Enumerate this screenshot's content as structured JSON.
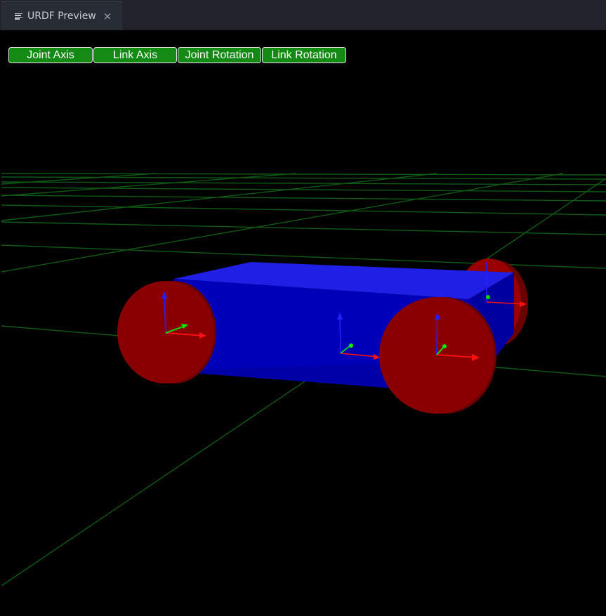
{
  "tab": {
    "title": "URDF Preview",
    "icon": "preview-lines-icon",
    "close_icon": "close-icon",
    "close_glyph": "×"
  },
  "toolbar": {
    "buttons": [
      {
        "label": "Joint Axis"
      },
      {
        "label": "Link Axis"
      },
      {
        "label": "Joint Rotation"
      },
      {
        "label": "Link Rotation"
      }
    ]
  },
  "scene": {
    "background": "#000000",
    "grid_color": "#0f5a14",
    "body_color": "#1a1aee",
    "wheel_color": "#8e0000",
    "axis_colors": {
      "x": "#ff0000",
      "y": "#00ff00",
      "z": "#0000ff"
    }
  }
}
